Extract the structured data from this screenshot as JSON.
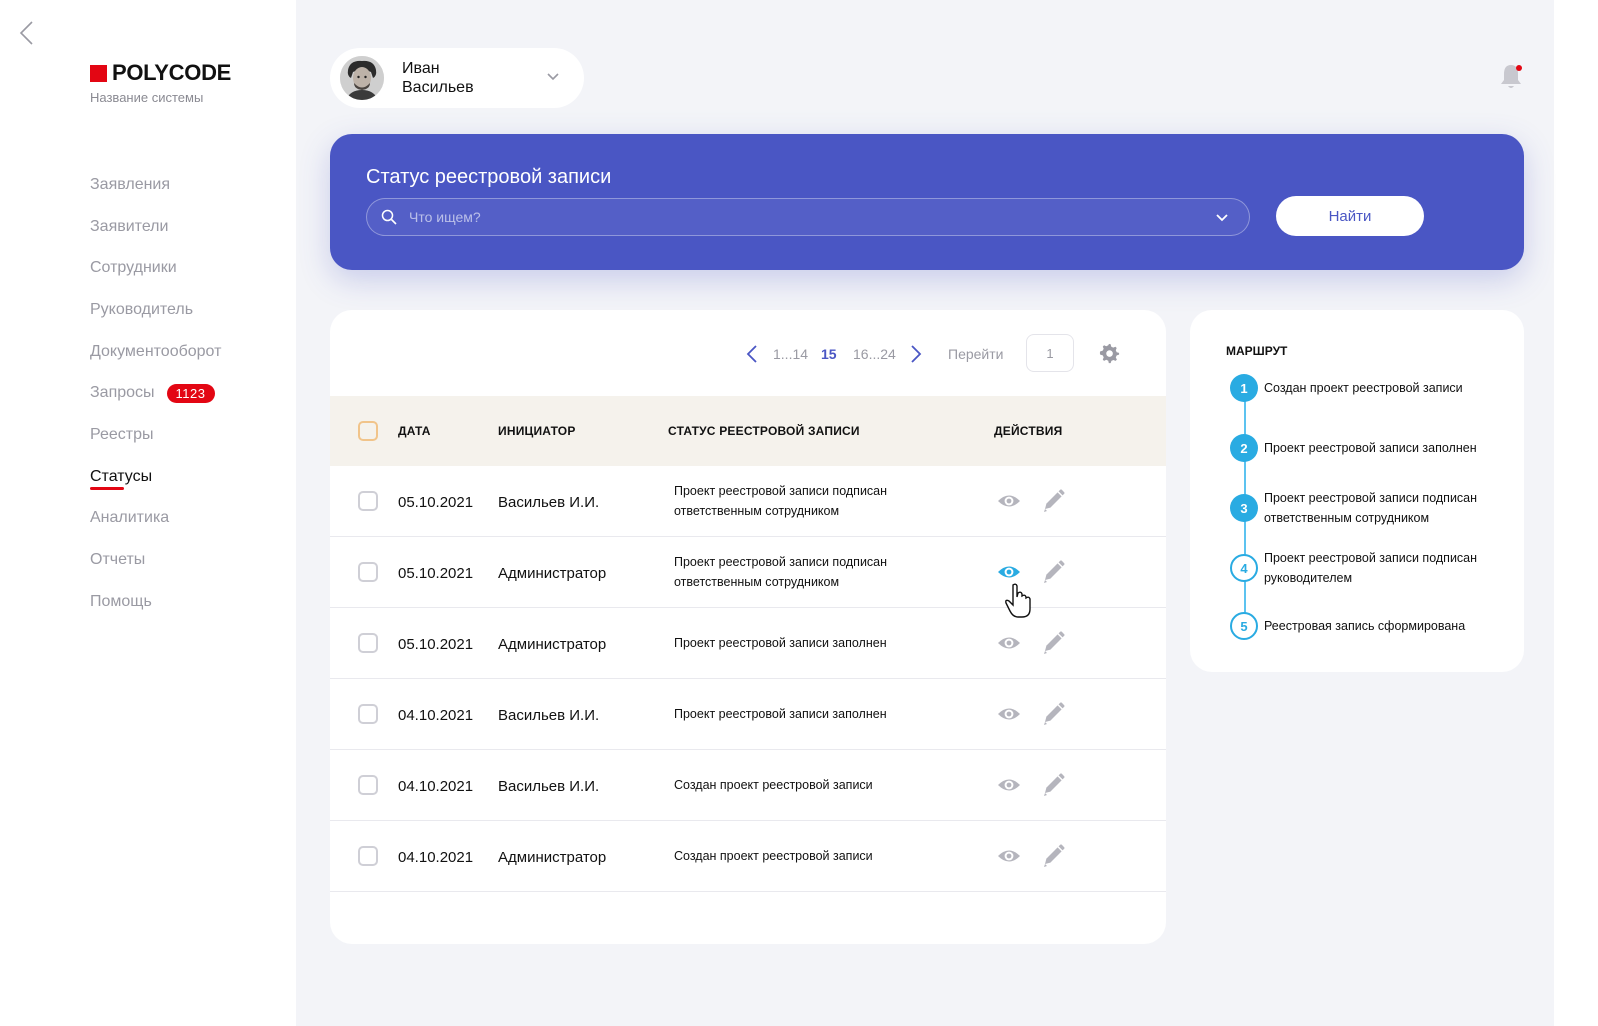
{
  "brand": {
    "logo_text": "POLYCODE",
    "system_name": "Название системы",
    "accent_color": "#e30613"
  },
  "sidebar": {
    "items": [
      {
        "label": "Заявления"
      },
      {
        "label": "Заявители"
      },
      {
        "label": "Сотрудники"
      },
      {
        "label": "Руководитель"
      },
      {
        "label": "Документооборот"
      },
      {
        "label": "Запросы",
        "badge": "1123"
      },
      {
        "label": "Реестры"
      },
      {
        "label": "Статусы",
        "active": true
      },
      {
        "label": "Аналитика"
      },
      {
        "label": "Отчеты"
      },
      {
        "label": "Помощь"
      }
    ]
  },
  "user": {
    "first_name": "Иван",
    "last_name": "Васильев"
  },
  "search": {
    "title": "Статус реестровой записи",
    "placeholder": "Что ищем?",
    "button_label": "Найти",
    "panel_color": "#4a56c4"
  },
  "pagination": {
    "prev_range": "1...14",
    "current": "15",
    "next_range": "16...24",
    "goto_label": "Перейти",
    "goto_value": "1"
  },
  "table": {
    "headers": {
      "date": "ДАТА",
      "initiator": "ИНИЦИАТОР",
      "status": "СТАТУС РЕЕСТРОВОЙ ЗАПИСИ",
      "actions": "ДЕЙСТВИЯ"
    },
    "rows": [
      {
        "date": "05.10.2021",
        "initiator": "Васильев И.И.",
        "status": "Проект реестровой записи подписан ответственным сотрудником",
        "view_active": false
      },
      {
        "date": "05.10.2021",
        "initiator": "Администратор",
        "status": "Проект реестровой записи подписан ответственным сотрудником",
        "view_active": true
      },
      {
        "date": "05.10.2021",
        "initiator": "Администратор",
        "status": "Проект реестровой записи заполнен",
        "view_active": false
      },
      {
        "date": "04.10.2021",
        "initiator": "Васильев И.И.",
        "status": "Проект реестровой записи заполнен",
        "view_active": false
      },
      {
        "date": "04.10.2021",
        "initiator": "Васильев И.И.",
        "status": "Создан проект реестровой записи",
        "view_active": false
      },
      {
        "date": "04.10.2021",
        "initiator": "Администратор",
        "status": "Создан проект реестровой записи",
        "view_active": false
      }
    ]
  },
  "route": {
    "title": "МАРШРУТ",
    "steps": [
      {
        "number": "1",
        "label": "Создан проект реестровой записи",
        "done": true
      },
      {
        "number": "2",
        "label": "Проект реестровой записи заполнен",
        "done": true
      },
      {
        "number": "3",
        "label": "Проект реестровой записи подписан ответственным сотрудником",
        "done": true
      },
      {
        "number": "4",
        "label": "Проект реестровой записи подписан руководителем",
        "done": false
      },
      {
        "number": "5",
        "label": "Реестровая запись сформирована",
        "done": false
      }
    ],
    "color": "#29abe2"
  }
}
